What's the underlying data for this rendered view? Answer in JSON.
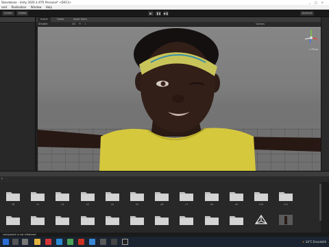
{
  "window": {
    "title": "Standalone - Unity 2020.3.47f1 Personal* <DX11>",
    "controls": [
      "_",
      "□",
      "×"
    ]
  },
  "menu": [
    "sset",
    "Realisation",
    "Window",
    "Help"
  ],
  "toolbar": {
    "center_label": "Center",
    "global_label": "Global",
    "play_icons": [
      "▶",
      "❚❚",
      "▶❚"
    ],
    "account_label": "Account"
  },
  "scene_tabs": [
    "Scene",
    "Game",
    "Asset Store"
  ],
  "scene_toolbar": {
    "shading_mode": "Shaded",
    "mode_2d": "2D",
    "gizmos_label": "Gizmos"
  },
  "gizmo": {
    "axis_y": "y",
    "axis_x": "x",
    "projection": "< Persp"
  },
  "project": {
    "row1_captions": [
      "18",
      "n1",
      "n2",
      "n3",
      "n4",
      "n5",
      "n6",
      "n7",
      "n8",
      "n9",
      "n10",
      "n11"
    ],
    "row2_captions": [
      "",
      "",
      "",
      "",
      "",
      "",
      "",
      "",
      "",
      "",
      "",
      ""
    ]
  },
  "status_bar": {
    "message": "component is not initialized"
  },
  "tray": {
    "temperature": "34°C",
    "weather": "Ensoleillé"
  },
  "colors": {
    "shirt": "#d6c83c",
    "headband": "#c9c45a",
    "skin": "#2e1d17",
    "viewport_bg": "#808080",
    "taskbar": "#1b2430"
  }
}
